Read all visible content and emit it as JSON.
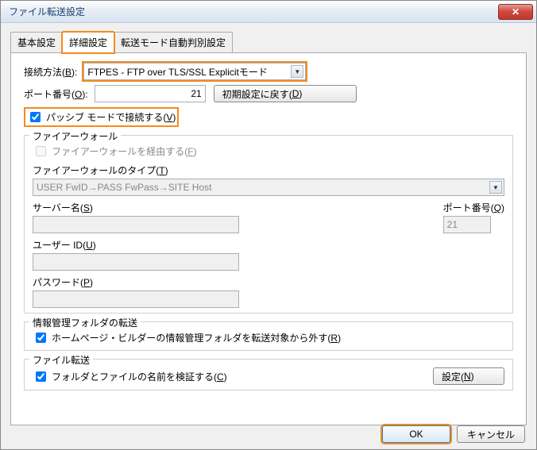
{
  "window": {
    "title": "ファイル転送設定"
  },
  "tabs": {
    "t0": "基本設定",
    "t1": "詳細設定",
    "t2": "転送モード自動判別設定",
    "active": 1
  },
  "conn": {
    "method_label_pre": "接続方法(",
    "method_key": "B",
    "method_label_post": "):",
    "method_value": "FTPES - FTP over TLS/SSL Explicitモード",
    "port_label_pre": "ポート番号(",
    "port_key": "O",
    "port_label_post": "):",
    "port_value": "21",
    "reset_btn_pre": "初期設定に戻す(",
    "reset_btn_key": "D",
    "reset_btn_post": ")",
    "pasv_pre": "パッシブ モードで接続する(",
    "pasv_key": "V",
    "pasv_post": ")",
    "pasv_checked": true
  },
  "fw": {
    "legend": "ファイアーウォール",
    "use_pre": "ファイアーウォールを経由する(",
    "use_key": "F",
    "use_post": ")",
    "type_pre": "ファイアーウォールのタイプ(",
    "type_key": "T",
    "type_post": ")",
    "type_value": "USER FwID→PASS FwPass→SITE Host",
    "server_pre": "サーバー名(",
    "server_key": "S",
    "server_post": ")",
    "port_pre": "ポート番号(",
    "port_key": "Q",
    "port_post": ")",
    "port_value": "21",
    "user_pre": "ユーザー ID(",
    "user_key": "U",
    "user_post": ")",
    "pass_pre": "パスワード(",
    "pass_key": "P",
    "pass_post": ")"
  },
  "mgmt": {
    "legend": "情報管理フォルダの転送",
    "opt_pre": "ホームページ・ビルダーの情報管理フォルダを転送対象から外す(",
    "opt_key": "R",
    "opt_post": ")",
    "checked": true
  },
  "ft": {
    "legend": "ファイル転送",
    "opt_pre": "フォルダとファイルの名前を検証する(",
    "opt_key": "C",
    "opt_post": ")",
    "checked": true,
    "btn_pre": "設定(",
    "btn_key": "N",
    "btn_post": ")"
  },
  "buttons": {
    "ok": "OK",
    "cancel": "キャンセル"
  }
}
